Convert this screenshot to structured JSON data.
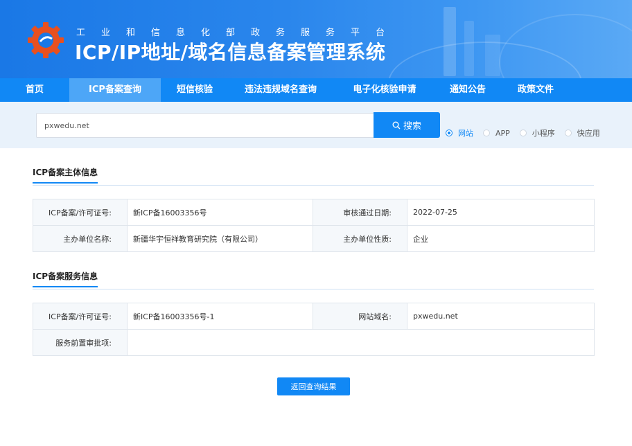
{
  "header": {
    "subtitle": "工业和信息化部政务服务平台",
    "title": "ICP/IP地址/域名信息备案管理系统"
  },
  "nav": {
    "items": [
      {
        "label": "首页",
        "active": false
      },
      {
        "label": "ICP备案查询",
        "active": true
      },
      {
        "label": "短信核验",
        "active": false
      },
      {
        "label": "违法违规域名查询",
        "active": false
      },
      {
        "label": "电子化核验申请",
        "active": false
      },
      {
        "label": "通知公告",
        "active": false
      },
      {
        "label": "政策文件",
        "active": false
      }
    ]
  },
  "search": {
    "value": "pxwedu.net",
    "button_label": "搜索",
    "options": [
      {
        "label": "网站",
        "checked": true
      },
      {
        "label": "APP",
        "checked": false
      },
      {
        "label": "小程序",
        "checked": false
      },
      {
        "label": "快应用",
        "checked": false
      }
    ]
  },
  "subject": {
    "title": "ICP备案主体信息",
    "rows": [
      [
        "ICP备案/许可证号:",
        "新ICP备16003356号",
        "审核通过日期:",
        "2022-07-25"
      ],
      [
        "主办单位名称:",
        "新疆华宇恒祥教育研究院（有限公司）",
        "主办单位性质:",
        "企业"
      ]
    ]
  },
  "service": {
    "title": "ICP备案服务信息",
    "rows": [
      [
        "ICP备案/许可证号:",
        "新ICP备16003356号-1",
        "网站域名:",
        "pxwedu.net"
      ],
      [
        "服务前置审批项:",
        ""
      ]
    ]
  },
  "back_label": "返回查询结果",
  "colors": {
    "primary": "#1188f5",
    "nav_active": "#4da6f7",
    "banner": "#1a78e6",
    "search_band": "#e9f2fb"
  }
}
